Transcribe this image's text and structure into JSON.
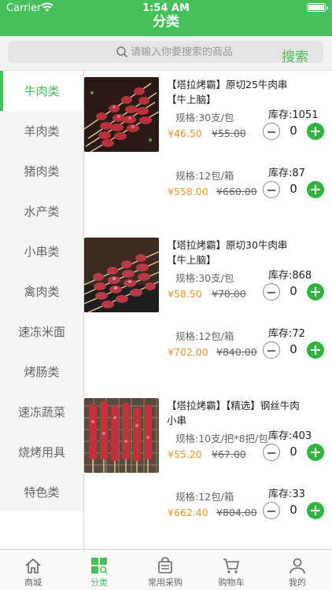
{
  "status": {
    "carrier": "Carrier",
    "time": "1:54 AM"
  },
  "header": {
    "title": "分类"
  },
  "search": {
    "placeholder": "请输入你要搜索的商品",
    "button": "搜索"
  },
  "sidebar": {
    "items": [
      {
        "label": "牛肉类",
        "active": true
      },
      {
        "label": "羊肉类"
      },
      {
        "label": "猪肉类"
      },
      {
        "label": "水产类"
      },
      {
        "label": "小串类"
      },
      {
        "label": "禽肉类"
      },
      {
        "label": "速冻米面"
      },
      {
        "label": "烤肠类"
      },
      {
        "label": "速冻蔬菜"
      },
      {
        "label": "烧烤用具"
      },
      {
        "label": "特色类"
      }
    ]
  },
  "products": [
    {
      "name": "【塔拉烤霸】原切25牛肉串【牛上脑】",
      "image": "beef-skewers-photo",
      "skus": [
        {
          "spec": "规格:30支/包",
          "stock": "库存:1051",
          "price": "¥46.50",
          "original_price": "¥55.00",
          "qty": "0"
        },
        {
          "spec": "规格:12包/箱",
          "stock": "库存:87",
          "price": "¥558.00",
          "original_price": "¥660.00",
          "qty": "0"
        }
      ]
    },
    {
      "name": "【塔拉烤霸】原切30牛肉串【牛上脑】",
      "image": "beef-skewers-photo",
      "skus": [
        {
          "spec": "规格:30支/包",
          "stock": "库存:868",
          "price": "¥58.50",
          "original_price": "¥70.00",
          "qty": "0"
        },
        {
          "spec": "规格:12包/箱",
          "stock": "库存:72",
          "price": "¥702.00",
          "original_price": "¥840.00",
          "qty": "0"
        }
      ]
    },
    {
      "name": "【塔拉烤霸】【精选】钢丝牛肉小串",
      "image": "beef-skewers-photo",
      "skus": [
        {
          "spec": "规格:10支/把*8把/包",
          "stock": "库存:403",
          "price": "¥55.20",
          "original_price": "¥67.00",
          "qty": "0"
        },
        {
          "spec": "规格:12包/箱",
          "stock": "库存:33",
          "price": "¥662.40",
          "original_price": "¥804.00",
          "qty": "0"
        }
      ]
    }
  ],
  "tabbar": {
    "items": [
      {
        "label": "商城",
        "icon": "home-icon"
      },
      {
        "label": "分类",
        "icon": "category-icon",
        "active": true
      },
      {
        "label": "常用采购",
        "icon": "purchase-bag-icon"
      },
      {
        "label": "购物车",
        "icon": "cart-icon"
      },
      {
        "label": "我的",
        "icon": "profile-icon"
      }
    ]
  },
  "colors": {
    "brand": "#45c05a",
    "price": "#f0922f",
    "plus": "#2fb53e"
  }
}
